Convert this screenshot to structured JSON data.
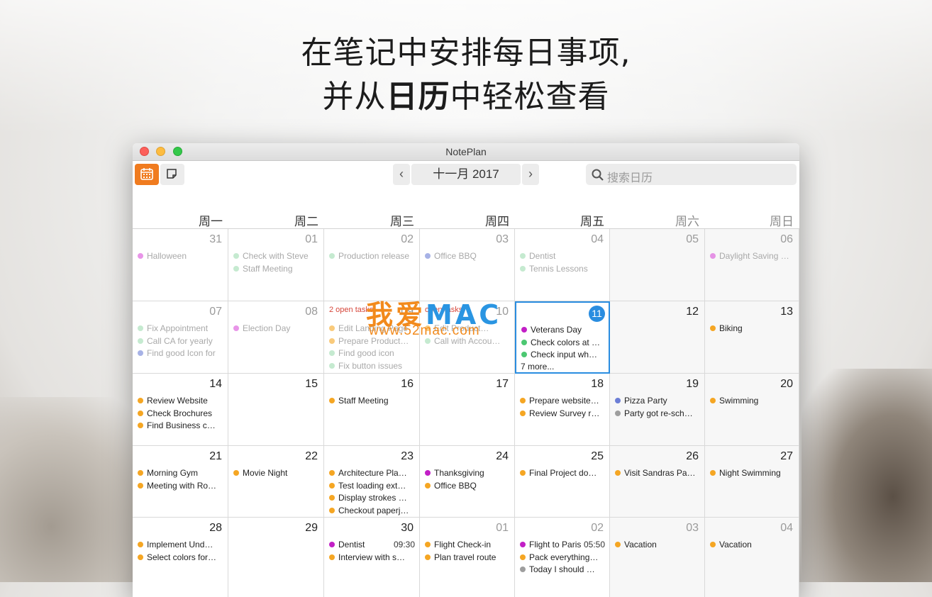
{
  "headline": {
    "line1": "在笔记中安排每日事项,",
    "line2_a": "并从",
    "line2_b": "日历",
    "line2_c": "中轻松查看"
  },
  "window": {
    "title": "NotePlan"
  },
  "toolbar": {
    "calendar_view_icon": "calendar-icon",
    "notes_view_icon": "note-icon",
    "prev": "‹",
    "next": "›",
    "month": "十一月 2017",
    "search_placeholder": "搜索日历",
    "accent": "#f07b1f"
  },
  "weekdays": [
    "周一",
    "周二",
    "周三",
    "周四",
    "周五",
    "周六",
    "周日"
  ],
  "watermark": {
    "line1_a": "我爱",
    "line1_b": "MAC",
    "line2": "www.52mac.com"
  },
  "colors": {
    "purple": "#d94fd8",
    "magenta": "#c21fc6",
    "green": "#4cc872",
    "lightgreen": "#9fdcb1",
    "blue": "#6c7ed6",
    "orange": "#f5a623",
    "gray": "#9e9e9e",
    "today": "#2a8de0",
    "red": "#d6463a"
  },
  "weeks": [
    [
      {
        "day": "31",
        "dim": true,
        "events": [
          {
            "t": "Halloween",
            "c": "purple"
          }
        ]
      },
      {
        "day": "01",
        "dim": true,
        "events": [
          {
            "t": "Check with Steve",
            "c": "lightgreen"
          },
          {
            "t": "Staff Meeting",
            "c": "lightgreen"
          }
        ]
      },
      {
        "day": "02",
        "dim": true,
        "events": [
          {
            "t": "Production release",
            "c": "lightgreen"
          }
        ]
      },
      {
        "day": "03",
        "dim": true,
        "events": [
          {
            "t": "Office BBQ",
            "c": "blue"
          }
        ]
      },
      {
        "day": "04",
        "dim": true,
        "events": [
          {
            "t": "Dentist",
            "c": "lightgreen"
          },
          {
            "t": "Tennis Lessons",
            "c": "lightgreen"
          }
        ]
      },
      {
        "day": "05",
        "dim": true,
        "events": []
      },
      {
        "day": "06",
        "dim": true,
        "events": [
          {
            "t": "Daylight Saving …",
            "c": "purple"
          }
        ]
      }
    ],
    [
      {
        "day": "07",
        "dim": true,
        "events": [
          {
            "t": "Fix Appointment",
            "c": "lightgreen"
          },
          {
            "t": "Call CA for yearly",
            "c": "lightgreen"
          },
          {
            "t": "Find good Icon for",
            "c": "blue"
          }
        ]
      },
      {
        "day": "08",
        "dim": true,
        "events": [
          {
            "t": "Election Day",
            "c": "purple"
          }
        ]
      },
      {
        "day": "09",
        "dim": true,
        "open": "2 open tasks",
        "events": [
          {
            "t": "Edit Landing Page",
            "c": "orange"
          },
          {
            "t": "Prepare Product…",
            "c": "orange"
          },
          {
            "t": "Find good icon",
            "c": "lightgreen"
          },
          {
            "t": "Fix button issues",
            "c": "lightgreen"
          }
        ]
      },
      {
        "day": "10",
        "dim": true,
        "open": "open tasks",
        "events": [
          {
            "t": "Edit Product…",
            "c": "orange"
          },
          {
            "t": "Call with Accou…",
            "c": "lightgreen"
          }
        ]
      },
      {
        "day": "11",
        "today": true,
        "events": [
          {
            "t": "Veterans Day",
            "c": "magenta"
          },
          {
            "t": "Check colors at …",
            "c": "green"
          },
          {
            "t": "Check input wh…",
            "c": "green"
          }
        ],
        "more": "7 more..."
      },
      {
        "day": "12",
        "events": []
      },
      {
        "day": "13",
        "events": [
          {
            "t": "Biking",
            "c": "orange"
          }
        ]
      }
    ],
    [
      {
        "day": "14",
        "events": [
          {
            "t": "Review Website",
            "c": "orange"
          },
          {
            "t": "Check Brochures",
            "c": "orange"
          },
          {
            "t": "Find Business c…",
            "c": "orange"
          }
        ]
      },
      {
        "day": "15",
        "events": []
      },
      {
        "day": "16",
        "events": [
          {
            "t": "Staff Meeting",
            "c": "orange"
          }
        ]
      },
      {
        "day": "17",
        "events": []
      },
      {
        "day": "18",
        "events": [
          {
            "t": "Prepare website…",
            "c": "orange"
          },
          {
            "t": "Review Survey r…",
            "c": "orange"
          }
        ]
      },
      {
        "day": "19",
        "events": [
          {
            "t": "Pizza Party",
            "c": "blue"
          },
          {
            "t": "Party got re-sch…",
            "c": "gray"
          }
        ]
      },
      {
        "day": "20",
        "events": [
          {
            "t": "Swimming",
            "c": "orange"
          }
        ]
      }
    ],
    [
      {
        "day": "21",
        "events": [
          {
            "t": "Morning Gym",
            "c": "orange"
          },
          {
            "t": "Meeting with Ro…",
            "c": "orange"
          }
        ]
      },
      {
        "day": "22",
        "events": [
          {
            "t": "Movie Night",
            "c": "orange"
          }
        ]
      },
      {
        "day": "23",
        "events": [
          {
            "t": "Architecture Pla…",
            "c": "orange"
          },
          {
            "t": "Test loading ext…",
            "c": "orange"
          },
          {
            "t": "Display strokes …",
            "c": "orange"
          },
          {
            "t": "Checkout paperj…",
            "c": "orange"
          }
        ]
      },
      {
        "day": "24",
        "events": [
          {
            "t": "Thanksgiving",
            "c": "magenta"
          },
          {
            "t": "Office BBQ",
            "c": "orange"
          }
        ]
      },
      {
        "day": "25",
        "events": [
          {
            "t": "Final Project do…",
            "c": "orange"
          }
        ]
      },
      {
        "day": "26",
        "events": [
          {
            "t": "Visit Sandras Pa…",
            "c": "orange"
          }
        ]
      },
      {
        "day": "27",
        "events": [
          {
            "t": "Night Swimming",
            "c": "orange"
          }
        ]
      }
    ],
    [
      {
        "day": "28",
        "events": [
          {
            "t": "Implement Und…",
            "c": "orange"
          },
          {
            "t": "Select colors for…",
            "c": "orange"
          }
        ]
      },
      {
        "day": "29",
        "events": []
      },
      {
        "day": "30",
        "events": [
          {
            "t": "Dentist",
            "c": "magenta",
            "time": "09:30"
          },
          {
            "t": "Interview with s…",
            "c": "orange"
          }
        ]
      },
      {
        "day": "01",
        "dimnum": true,
        "events": [
          {
            "t": "Flight Check-in",
            "c": "orange"
          },
          {
            "t": "Plan travel route",
            "c": "orange"
          }
        ]
      },
      {
        "day": "02",
        "dimnum": true,
        "events": [
          {
            "t": "Flight to Paris",
            "c": "magenta",
            "time": "05:50"
          },
          {
            "t": "Pack everything…",
            "c": "orange"
          },
          {
            "t": "Today I should …",
            "c": "gray"
          }
        ]
      },
      {
        "day": "03",
        "dimnum": true,
        "events": [
          {
            "t": "Vacation",
            "c": "orange"
          }
        ]
      },
      {
        "day": "04",
        "dimnum": true,
        "events": [
          {
            "t": "Vacation",
            "c": "orange"
          }
        ]
      }
    ]
  ]
}
